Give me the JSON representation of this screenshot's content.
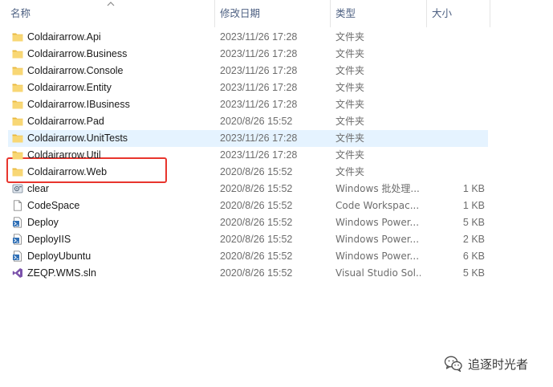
{
  "columns": {
    "name": "名称",
    "date": "修改日期",
    "type": "类型",
    "size": "大小"
  },
  "files": [
    {
      "name": "Coldairarrow.Api",
      "date": "2023/11/26 17:28",
      "type": "文件夹",
      "size": "",
      "icon": "folder-icon"
    },
    {
      "name": "Coldairarrow.Business",
      "date": "2023/11/26 17:28",
      "type": "文件夹",
      "size": "",
      "icon": "folder-icon"
    },
    {
      "name": "Coldairarrow.Console",
      "date": "2023/11/26 17:28",
      "type": "文件夹",
      "size": "",
      "icon": "folder-icon"
    },
    {
      "name": "Coldairarrow.Entity",
      "date": "2023/11/26 17:28",
      "type": "文件夹",
      "size": "",
      "icon": "folder-icon"
    },
    {
      "name": "Coldairarrow.IBusiness",
      "date": "2023/11/26 17:28",
      "type": "文件夹",
      "size": "",
      "icon": "folder-icon"
    },
    {
      "name": "Coldairarrow.Pad",
      "date": "2020/8/26 15:52",
      "type": "文件夹",
      "size": "",
      "icon": "folder-icon"
    },
    {
      "name": "Coldairarrow.UnitTests",
      "date": "2023/11/26 17:28",
      "type": "文件夹",
      "size": "",
      "icon": "folder-icon"
    },
    {
      "name": "Coldairarrow.Util",
      "date": "2023/11/26 17:28",
      "type": "文件夹",
      "size": "",
      "icon": "folder-icon"
    },
    {
      "name": "Coldairarrow.Web",
      "date": "2020/8/26 15:52",
      "type": "文件夹",
      "size": "",
      "icon": "folder-icon"
    },
    {
      "name": "clear",
      "date": "2020/8/26 15:52",
      "type": "Windows 批处理...",
      "size": "1 KB",
      "icon": "batch-file-icon"
    },
    {
      "name": "CodeSpace",
      "date": "2020/8/26 15:52",
      "type": "Code Workspac...",
      "size": "1 KB",
      "icon": "document-icon"
    },
    {
      "name": "Deploy",
      "date": "2020/8/26 15:52",
      "type": "Windows Power...",
      "size": "5 KB",
      "icon": "powershell-icon"
    },
    {
      "name": "DeployIIS",
      "date": "2020/8/26 15:52",
      "type": "Windows Power...",
      "size": "2 KB",
      "icon": "powershell-icon"
    },
    {
      "name": "DeployUbuntu",
      "date": "2020/8/26 15:52",
      "type": "Windows Power...",
      "size": "6 KB",
      "icon": "powershell-icon"
    },
    {
      "name": "ZEQP.WMS.sln",
      "date": "2020/8/26 15:52",
      "type": "Visual Studio Sol...",
      "size": "5 KB",
      "icon": "visual-studio-icon"
    }
  ],
  "hovered_row": 6,
  "highlighted_row": 8,
  "watermark": {
    "text": "追逐时光者",
    "icon": "wechat-icon"
  },
  "colors": {
    "folder": "#f8d775",
    "hover": "#e5f3ff",
    "highlight_border": "#e8352d",
    "header_text": "#4d6082"
  }
}
